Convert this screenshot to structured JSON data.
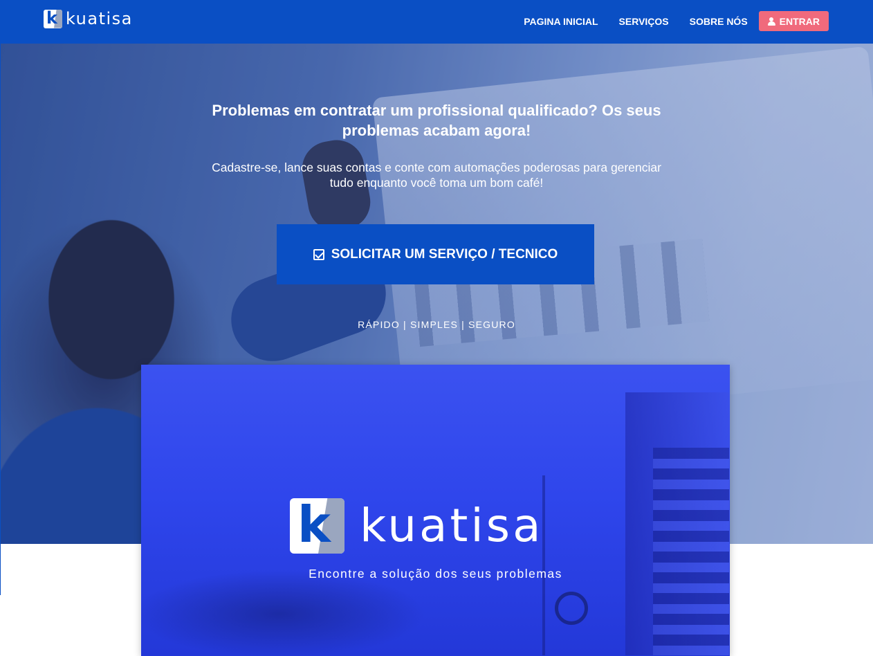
{
  "navbar": {
    "brand_mark": "k",
    "brand_text": "kuatisa",
    "links": [
      {
        "label": "PAGINA INICIAL"
      },
      {
        "label": "SERVIÇOS"
      },
      {
        "label": "SOBRE NÓS"
      }
    ],
    "login_label": "ENTRAR",
    "login_icon": "user-icon",
    "background_color": "#0a4fc4",
    "login_color": "#f06a7c"
  },
  "hero": {
    "title": "Problemas em contratar um profissional qualificado? Os seus problemas acabam agora!",
    "subtitle": "Cadastre-se, lance suas contas e conte com automações poderosas para gerenciar tudo enquanto você toma um bom café!",
    "cta_label": "SOLICITAR UM SERVIÇO / TECNICO",
    "cta_icon": "check-square-icon",
    "tagline": "RÁPIDO | SIMPLES | SEGURO"
  },
  "banner": {
    "mark": "k",
    "wordmark": "kuatisa",
    "slogan": "Encontre a solução dos seus problemas"
  }
}
